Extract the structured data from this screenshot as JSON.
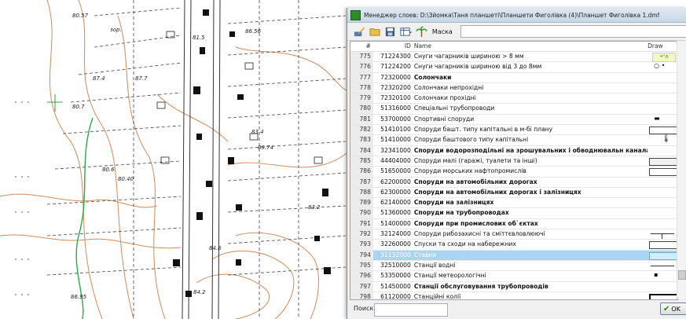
{
  "window": {
    "title": "Менеджер слоев: D:\\Зйомка\\Таня планшеті\\Планшети Фиголівка (4)\\Планшет Фиголівка 1.dmf"
  },
  "toolbar": {
    "mask_label": "Маска",
    "mask_value": ""
  },
  "table": {
    "headers": {
      "num": "#",
      "id": "ID",
      "name": "Name",
      "draw": "Draw"
    },
    "rows": [
      {
        "num": "775",
        "id": "71224300",
        "name": "Снуги чагарників шириною > 8 мм",
        "bold": false
      },
      {
        "num": "776",
        "id": "71224200",
        "name": "Снуги чагарників шириною від 3 до 8мм",
        "bold": false
      },
      {
        "num": "777",
        "id": "72320000",
        "name": "Солончаки",
        "bold": true
      },
      {
        "num": "778",
        "id": "72320200",
        "name": "Солончаки непрохідні",
        "bold": false
      },
      {
        "num": "779",
        "id": "72320100",
        "name": "Солончаки прохідні",
        "bold": false
      },
      {
        "num": "780",
        "id": "51316000",
        "name": "Спеціальні трубопроводи",
        "bold": false
      },
      {
        "num": "781",
        "id": "53700000",
        "name": "Спортивні споруди",
        "bold": false
      },
      {
        "num": "782",
        "id": "51410100",
        "name": "Споруди башт. типу капітальні в м-бі плану",
        "bold": false
      },
      {
        "num": "783",
        "id": "51410000",
        "name": "Споруди баштового типу капітальні",
        "bold": false
      },
      {
        "num": "784",
        "id": "32341000",
        "name": "Споруди водорозподільні на зрошувальних і обводнювальн каналах",
        "bold": true
      },
      {
        "num": "785",
        "id": "44404000",
        "name": "Споруди малі (гаражі, туалети та інші)",
        "bold": false
      },
      {
        "num": "786",
        "id": "51650000",
        "name": "Споруди морських нафтопромислів",
        "bold": false
      },
      {
        "num": "787",
        "id": "62200000",
        "name": "Споруди на автомобільних дорогах",
        "bold": true
      },
      {
        "num": "788",
        "id": "62300000",
        "name": "Споруди на автомобільних дорогах і залізницях",
        "bold": true
      },
      {
        "num": "789",
        "id": "62140000",
        "name": "Споруди на залізницях",
        "bold": true
      },
      {
        "num": "790",
        "id": "51360000",
        "name": "Споруди на трубопроводах",
        "bold": true
      },
      {
        "num": "791",
        "id": "51400000",
        "name": "Споруди при промислових об`єктах",
        "bold": true
      },
      {
        "num": "792",
        "id": "32124000",
        "name": "Споруди рибозахисні та сміттєвловлюючі",
        "bold": false
      },
      {
        "num": "793",
        "id": "32260000",
        "name": "Спуски та сходи на набережних",
        "bold": false
      },
      {
        "num": "794",
        "id": "31132000",
        "name": "Ставки",
        "bold": false,
        "selected": true
      },
      {
        "num": "795",
        "id": "32510000",
        "name": "Станції водні",
        "bold": false
      },
      {
        "num": "796",
        "id": "53350000",
        "name": "Станції метеорологічні",
        "bold": false
      },
      {
        "num": "797",
        "id": "51450000",
        "name": "Станції обслуговування трубопроводів",
        "bold": true
      },
      {
        "num": "798",
        "id": "61120000",
        "name": "Станційні колії",
        "bold": false
      }
    ]
  },
  "footer": {
    "search_label": "Поиск",
    "search_value": "",
    "ok_label": "OK"
  },
  "map": {
    "labels": [
      "зор.",
      "80.57",
      "86.56",
      "81.5",
      "80.7",
      "87.4",
      "87.7",
      "83.4",
      "89.74",
      "80.6",
      "80.40",
      "83.2",
      "84.8",
      "84.2",
      "86.95"
    ]
  },
  "colors": {
    "contour": "#d08a5a",
    "water": "#2aa84a",
    "selection": "#a8d4f5"
  }
}
